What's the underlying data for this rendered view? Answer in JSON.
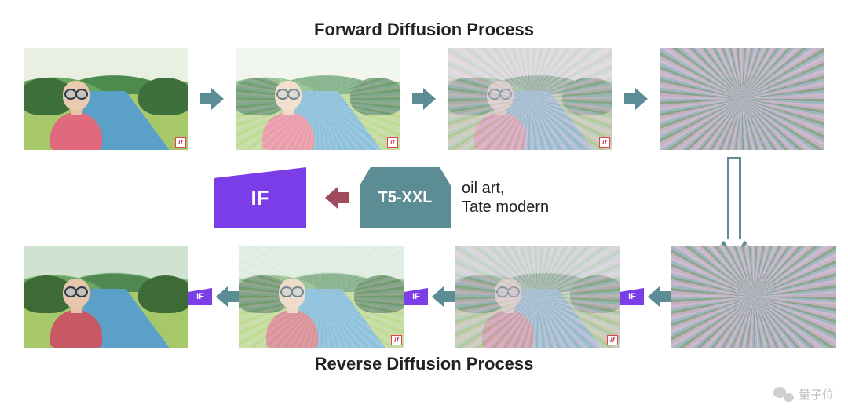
{
  "titles": {
    "forward": "Forward Diffusion Process",
    "reverse": "Reverse Diffusion Process"
  },
  "blocks": {
    "if_label": "IF",
    "t5_label": "T5-XXL"
  },
  "prompt": {
    "line1": "oil art,",
    "line2": "Tate modern"
  },
  "mini_if": "IF",
  "tile_badge": "if",
  "watermark": "量子位"
}
